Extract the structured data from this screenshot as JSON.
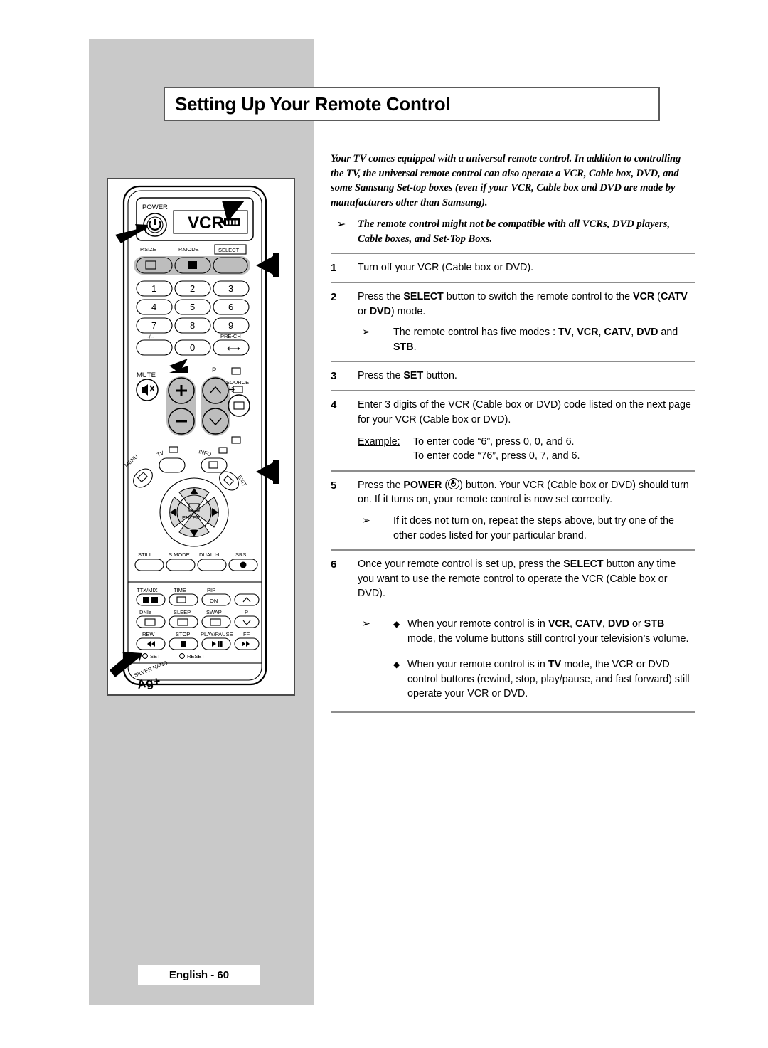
{
  "page": {
    "title": "Setting Up Your Remote Control",
    "footer": "English - 60",
    "panel_color": "#c9c9c9"
  },
  "intro": {
    "paragraph": "Your TV comes equipped with a universal remote control. In addition to controlling the TV, the universal remote control can also operate a VCR, Cable box, DVD, and some Samsung Set-top boxes (even if your VCR, Cable box and DVD are made by manufacturers other than Samsung).",
    "note_arrow": "➢",
    "note": "The remote control might not be compatible with all VCRs, DVD players, Cable boxes, and Set-Top Boxs."
  },
  "steps": [
    {
      "num": "1",
      "text_html": "Turn off your VCR (Cable box or DVD)."
    },
    {
      "num": "2",
      "text_html": "Press the <b>SELECT</b> button to switch the remote control to the <b>VCR</b> (<b>CATV</b> or <b>DVD</b>) mode.",
      "sub_arrow": "➢",
      "sub_html": "The remote control has five modes : <b>TV</b>, <b>VCR</b>, <b>CATV</b>, <b>DVD</b> and <b>STB</b>."
    },
    {
      "num": "3",
      "text_html": "Press the <b>SET</b> button."
    },
    {
      "num": "4",
      "text_html": "Enter 3 digits of the VCR (Cable box or DVD) code listed on the next page for your VCR (Cable box or DVD).",
      "example_label": "Example:",
      "example_lines": [
        "To enter code “6”, press 0, 0, and 6.",
        "To enter code “76”, press 0, 7, and 6."
      ]
    },
    {
      "num": "5",
      "text_html": "Press the <b>POWER</b> (<span class=\"pwr-glyph\"></span>) button. Your VCR (Cable box or DVD) should turn on. If it turns on, your remote control is now set correctly.",
      "sub_arrow": "➢",
      "sub_html": "If it does not turn on, repeat the steps above, but try one of the other codes listed for your particular brand."
    },
    {
      "num": "6",
      "text_html": "Once your remote control is set up, press the <b>SELECT</b> button any time you want to use the remote control to operate the VCR (Cable box or DVD).",
      "sub_arrow": "➢",
      "bullets": [
        {
          "marker": "◆",
          "html": "When your remote control is in <b>VCR</b>, <b>CATV</b>, <b>DVD</b> or <b>STB</b> mode, the volume buttons still control your television’s volume."
        },
        {
          "marker": "◆",
          "html": "When your remote control is in <b>TV</b> mode, the VCR or DVD control buttons (rewind, stop, play/pause, and fast forward) still operate your VCR or DVD."
        }
      ]
    }
  ],
  "remote": {
    "display_mode": "VCR",
    "power_label": "POWER",
    "battery_icon": "battery-icon",
    "mode_row": [
      "P.SIZE",
      "P.MODE",
      "SELECT"
    ],
    "numbers": [
      "1",
      "2",
      "3",
      "4",
      "5",
      "6",
      "7",
      "8",
      "9",
      "-/--",
      "0",
      "PRE-CH"
    ],
    "mute_label": "MUTE",
    "volume_label_icon": "volume-icon",
    "channel_label": "P",
    "source_label": "SOURCE",
    "menu_label": "MENU",
    "tv_label": "TV",
    "info_label": "INFO",
    "exit_label": "EXIT",
    "enter_label": "ENTER",
    "function_row": [
      "STILL",
      "S.MODE",
      "DUAL I-II",
      "SRS"
    ],
    "lower_rows": [
      [
        "TTX/MIX",
        "TIME",
        "PIP",
        ""
      ],
      [
        "DNIe",
        "SLEEP",
        "SWAP",
        "P"
      ],
      [
        "REW",
        "STOP",
        "PLAY/PAUSE",
        "FF"
      ]
    ],
    "pip_on_label": "ON",
    "set_label": "SET",
    "reset_label": "RESET",
    "brand_line1": "SILVER NANO",
    "brand_line2": "Ag+"
  }
}
